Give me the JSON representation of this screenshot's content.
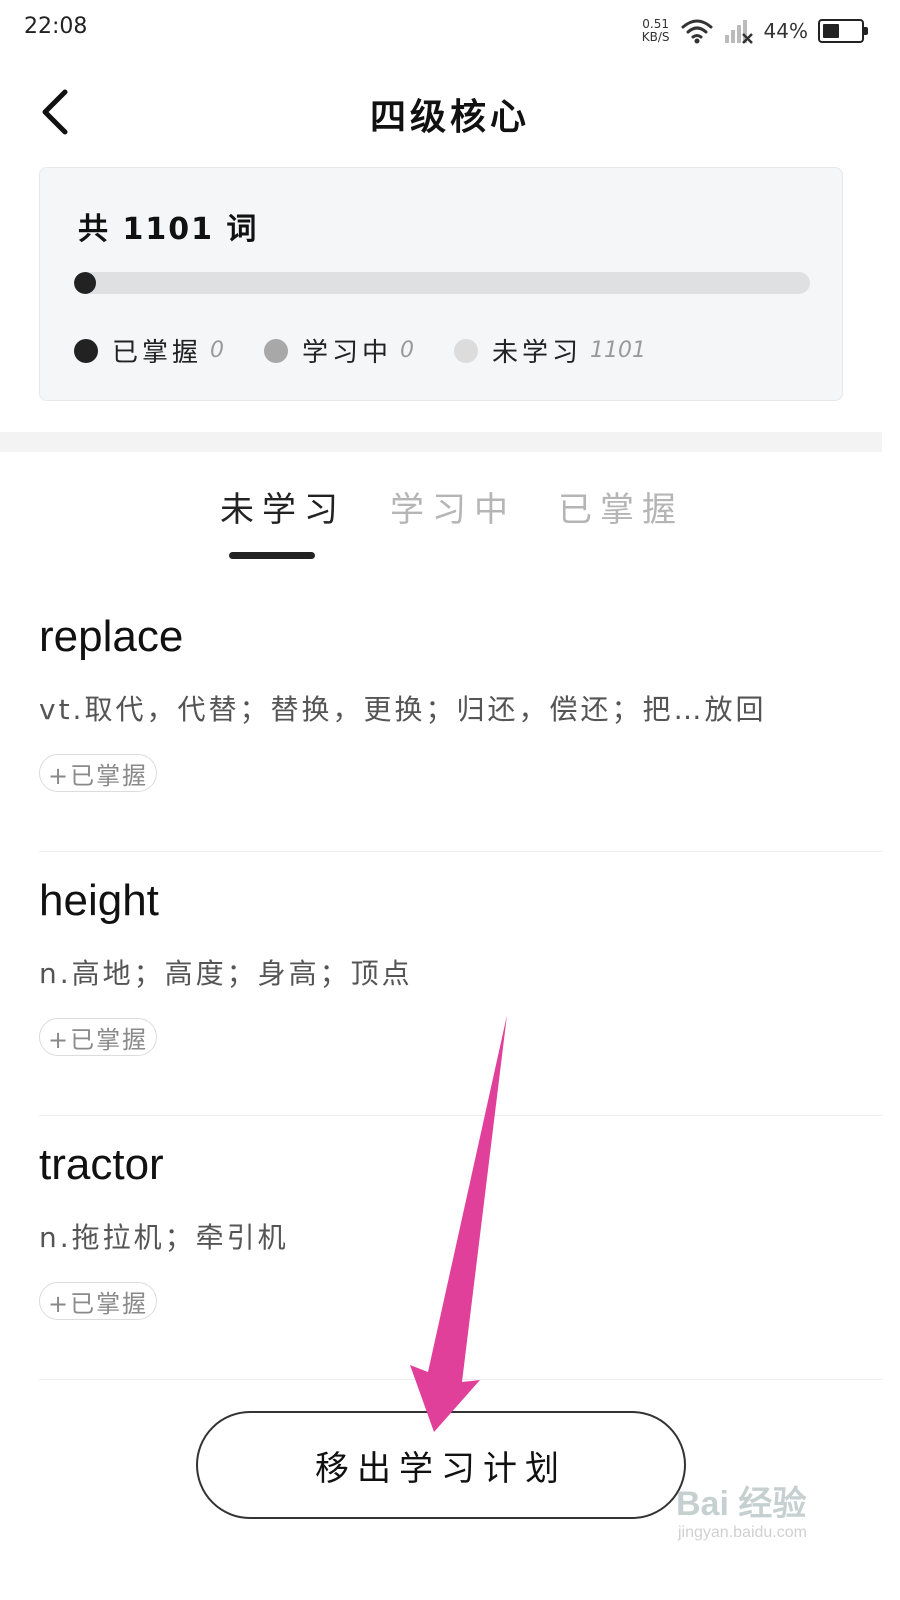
{
  "status_bar": {
    "time": "22:08",
    "speed_value": "0.51",
    "speed_unit": "KB/S",
    "battery_percent": "44%",
    "battery_level": 0.44
  },
  "header": {
    "title": "四级核心"
  },
  "summary": {
    "total_text": "共 1101 词",
    "progress_fraction": 0.0,
    "legend": [
      {
        "label": "已掌握",
        "count": "0",
        "color": "#222222"
      },
      {
        "label": "学习中",
        "count": "0",
        "color": "#a8a8a8"
      },
      {
        "label": "未学习",
        "count": "1101",
        "color": "#dcdcdc"
      }
    ]
  },
  "tabs": [
    {
      "label": "未学习",
      "active": true
    },
    {
      "label": "学习中",
      "active": false
    },
    {
      "label": "已掌握",
      "active": false
    }
  ],
  "words": [
    {
      "word": "replace",
      "meaning": "vt.取代，代替；替换，更换；归还，偿还；把…放回",
      "action": "+已掌握"
    },
    {
      "word": "height",
      "meaning": "n.高地；高度；身高；顶点",
      "action": "+已掌握"
    },
    {
      "word": "tractor",
      "meaning": "n.拖拉机；牵引机",
      "action": "+已掌握"
    }
  ],
  "bottom_button": {
    "label": "移出学习计划"
  },
  "watermark": {
    "brand": "Bai 经验",
    "url": "jingyan.baidu.com"
  },
  "colors": {
    "annotation_arrow": "#e0409a",
    "accent": "#222222"
  }
}
